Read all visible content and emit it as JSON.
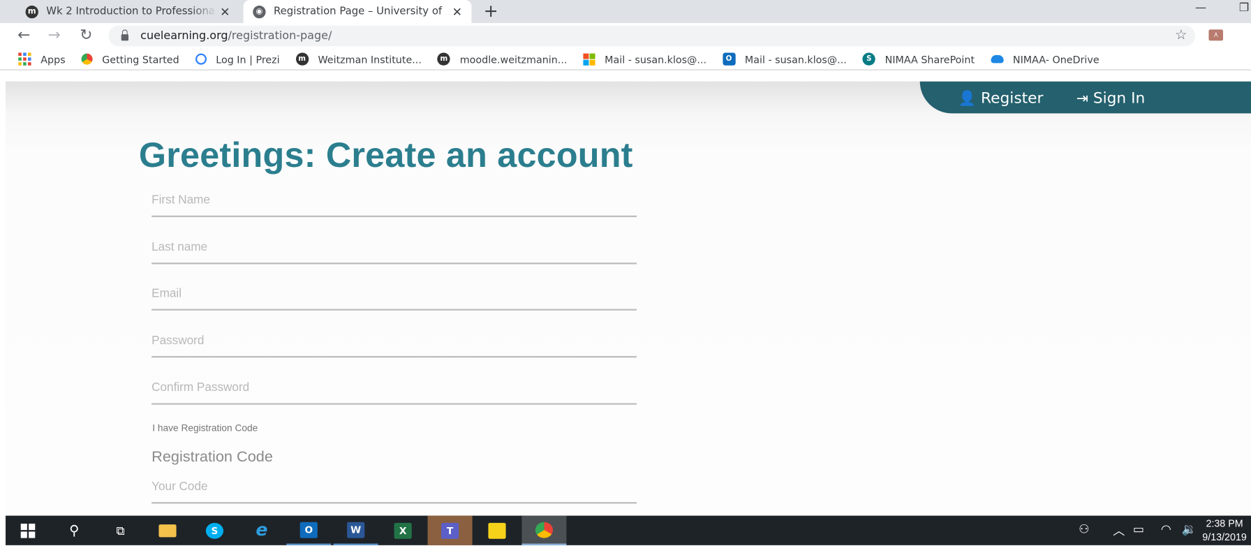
{
  "browser": {
    "tabs": [
      {
        "title": "Wk 2 Introduction to Professiona",
        "icon": "moodle-icon",
        "active": false
      },
      {
        "title": "Registration Page – University of",
        "icon": "globe-icon",
        "active": true
      }
    ],
    "new_tab_symbol": "+",
    "minimize_symbol": "—",
    "url_host": "cuelearning.org",
    "url_path": "/registration-page/",
    "bookmarks": [
      {
        "label": "Apps",
        "icon": "apps-grid-icon"
      },
      {
        "label": "Getting Started",
        "icon": "chrome-icon"
      },
      {
        "label": "Log In | Prezi",
        "icon": "prezi-icon"
      },
      {
        "label": "Weitzman Institute...",
        "icon": "moodle-icon"
      },
      {
        "label": "moodle.weitzmanin...",
        "icon": "moodle-icon"
      },
      {
        "label": "Mail - susan.klos@...",
        "icon": "microsoft-icon"
      },
      {
        "label": "Mail - susan.klos@...",
        "icon": "outlook-icon"
      },
      {
        "label": "NIMAA SharePoint",
        "icon": "sharepoint-icon"
      },
      {
        "label": "NIMAA- OneDrive",
        "icon": "onedrive-icon"
      }
    ]
  },
  "site": {
    "nav": {
      "register": "Register",
      "sign_in": "Sign In"
    },
    "heading": "Greetings: Create an account",
    "fields": {
      "first_name": "First Name",
      "last_name": "Last name",
      "email": "Email",
      "password": "Password",
      "confirm_password": "Confirm Password"
    },
    "registration_code_checkbox": "I have Registration Code",
    "registration_code_title": "Registration Code",
    "registration_code_placeholder": "Your Code",
    "accent_color": "#2b7e8e",
    "header_color": "#24606d"
  },
  "taskbar": {
    "time": "2:38 PM",
    "date": "9/13/2019",
    "apps": [
      "start",
      "search",
      "task-view",
      "file-explorer",
      "skype",
      "internet-explorer",
      "outlook",
      "word",
      "excel",
      "teams",
      "sticky-notes",
      "chrome"
    ]
  }
}
